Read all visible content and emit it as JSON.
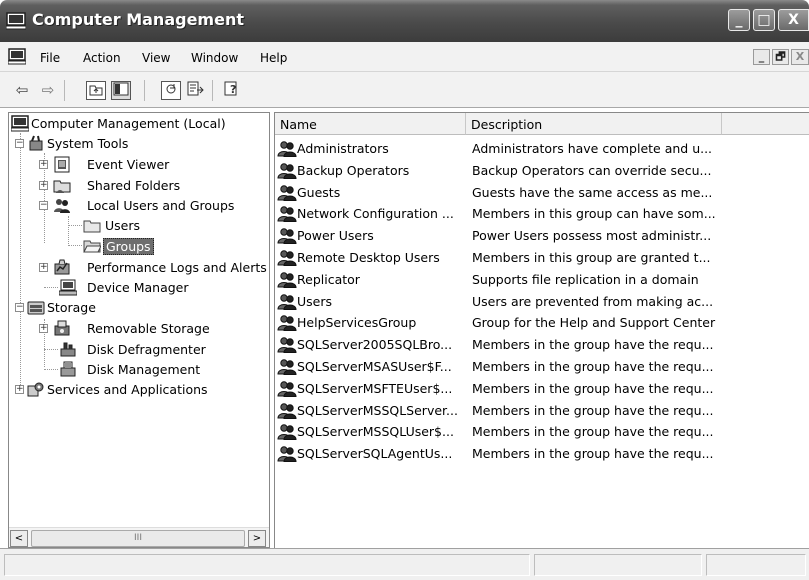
{
  "window": {
    "title": "Computer Management",
    "controls": {
      "minimize": "_",
      "maximize": "□",
      "close": "X"
    }
  },
  "menu": {
    "items": [
      "File",
      "Action",
      "View",
      "Window",
      "Help"
    ],
    "mdi_controls": {
      "minimize": "_",
      "restore": "🗗",
      "close": "X"
    }
  },
  "toolbar": {
    "buttons": [
      "back-icon",
      "forward-icon",
      "up-one-level-icon",
      "show-hide-console-tree-icon",
      "refresh-icon",
      "export-list-icon",
      "help-icon"
    ]
  },
  "tree": {
    "root": "Computer Management (Local)",
    "system_tools": "System Tools",
    "event_viewer": "Event Viewer",
    "shared_folders": "Shared Folders",
    "local_users_groups": "Local Users and Groups",
    "users": "Users",
    "groups": "Groups",
    "perf_logs": "Performance Logs and Alerts",
    "device_manager": "Device Manager",
    "storage": "Storage",
    "removable_storage": "Removable Storage",
    "disk_defrag": "Disk Defragmenter",
    "disk_mgmt": "Disk Management",
    "services_apps": "Services and Applications",
    "selected": "Groups"
  },
  "list": {
    "columns": [
      "Name",
      "Description"
    ],
    "rows": [
      {
        "name": "Administrators",
        "description": "Administrators have complete and u..."
      },
      {
        "name": "Backup Operators",
        "description": "Backup Operators can override secu..."
      },
      {
        "name": "Guests",
        "description": "Guests have the same access as me..."
      },
      {
        "name": "Network Configuration ...",
        "description": "Members in this group can have som..."
      },
      {
        "name": "Power Users",
        "description": "Power Users possess most administr..."
      },
      {
        "name": "Remote Desktop Users",
        "description": "Members in this group are granted t..."
      },
      {
        "name": "Replicator",
        "description": "Supports file replication in a domain"
      },
      {
        "name": "Users",
        "description": "Users are prevented from making ac..."
      },
      {
        "name": "HelpServicesGroup",
        "description": "Group for the Help and Support Center"
      },
      {
        "name": "SQLServer2005SQLBro...",
        "description": "Members in the group have the requ..."
      },
      {
        "name": "SQLServerMSASUser$F...",
        "description": "Members in the group have the requ..."
      },
      {
        "name": "SQLServerMSFTEUser$...",
        "description": "Members in the group have the requ..."
      },
      {
        "name": "SQLServerMSSQLServer...",
        "description": "Members in the group have the requ..."
      },
      {
        "name": "SQLServerMSSQLUser$...",
        "description": "Members in the group have the requ..."
      },
      {
        "name": "SQLServerSQLAgentUs...",
        "description": "Members in the group have the requ..."
      }
    ]
  },
  "scrollbar": {
    "left_arrow": "<",
    "right_arrow": ">",
    "thumb_grip": "III"
  }
}
